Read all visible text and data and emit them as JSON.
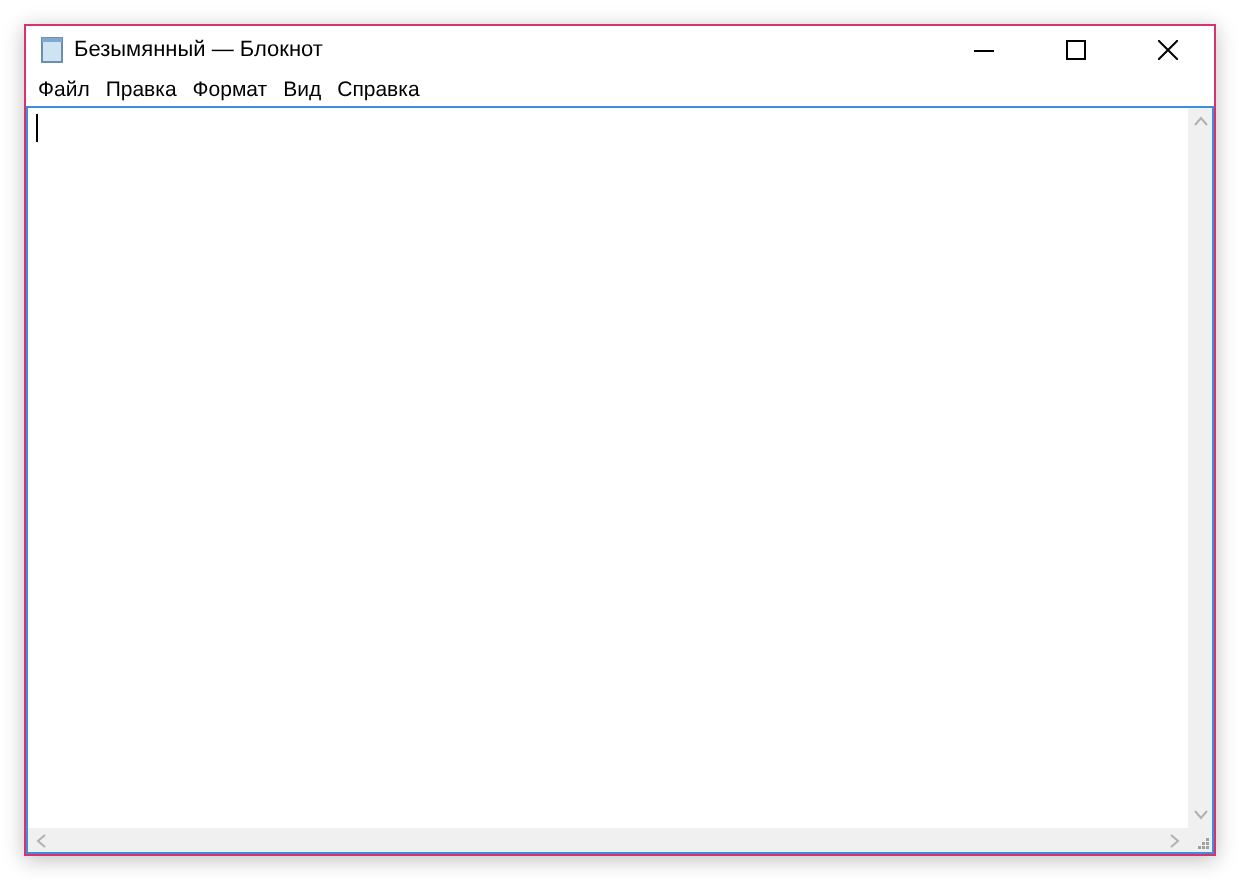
{
  "window": {
    "title": "Безымянный — Блокнот"
  },
  "menu": [
    {
      "label": "Файл"
    },
    {
      "label": "Правка"
    },
    {
      "label": "Формат"
    },
    {
      "label": "Вид"
    },
    {
      "label": "Справка"
    }
  ]
}
